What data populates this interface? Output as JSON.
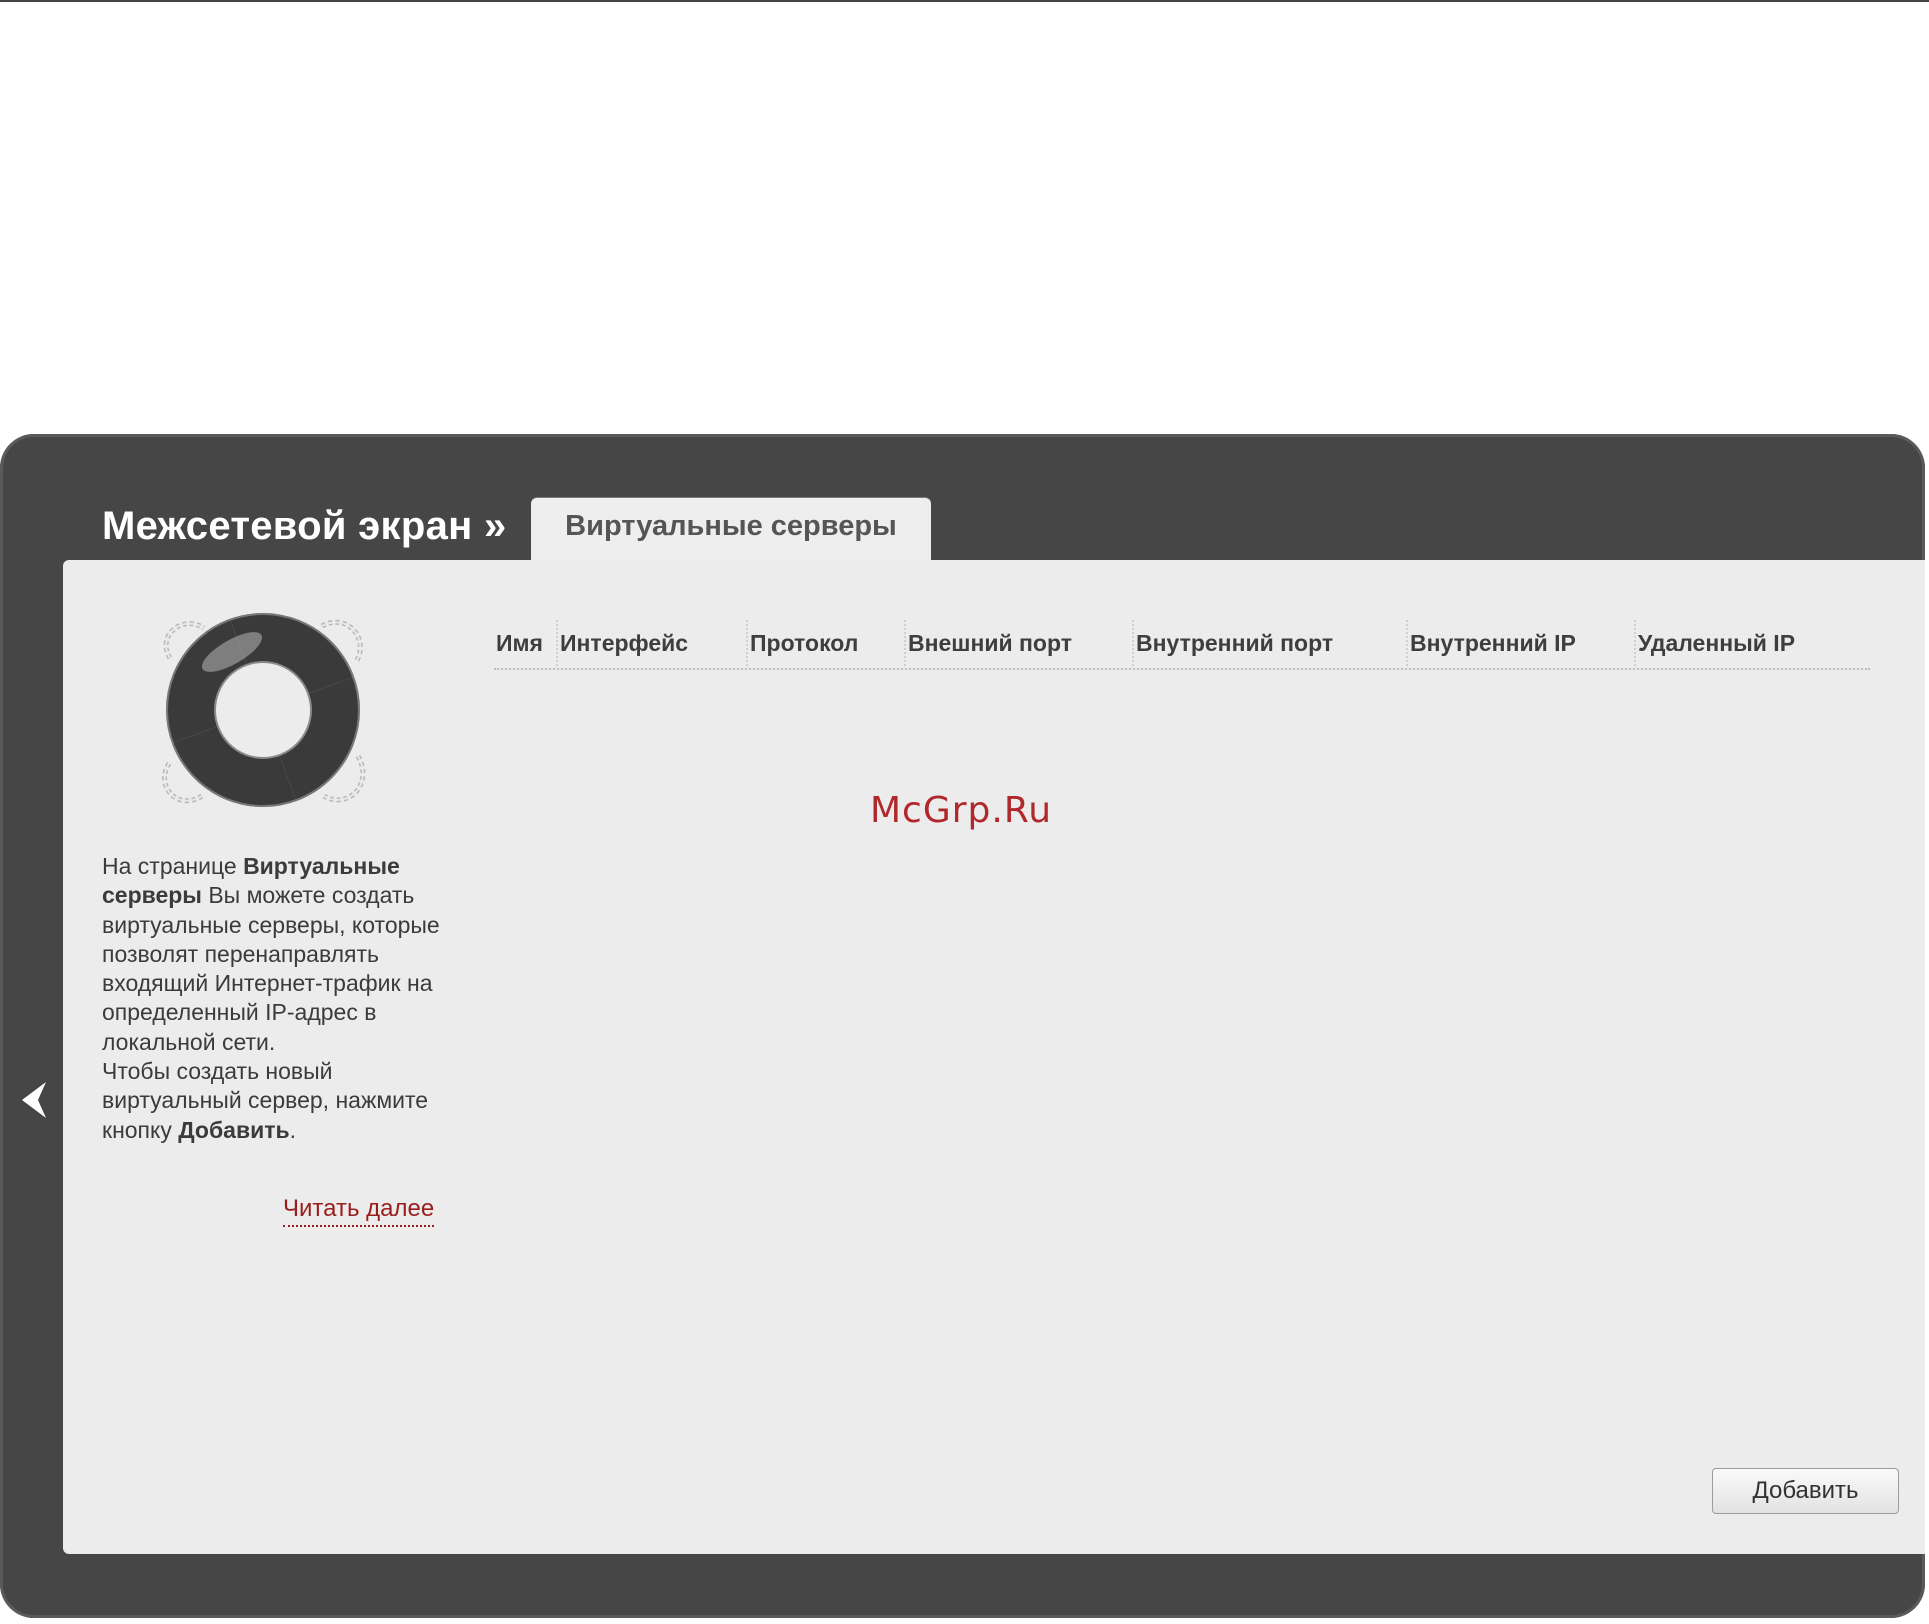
{
  "page": {
    "section_title": "Межсетевой экран »",
    "active_tab": "Виртуальные серверы"
  },
  "sidebar": {
    "help_text": {
      "prefix": "На странице ",
      "page_name": "Виртуальные серверы",
      "body": " Вы можете создать виртуальные серверы, которые позволят перенаправлять входящий Интернет-трафик на определенный IP-адрес в локальной сети.",
      "line2": "Чтобы создать новый виртуальный сервер, нажмите кнопку ",
      "button_name": "Добавить",
      "suffix": "."
    },
    "read_more_label": "Читать далее",
    "back_icon": "chevron-left-icon",
    "illustration_icon": "lifebuoy-icon"
  },
  "table": {
    "columns": [
      "Имя",
      "Интерфейс",
      "Протокол",
      "Внешний порт",
      "Внутренний порт",
      "Внутренний IP",
      "Удаленный IP"
    ],
    "rows": []
  },
  "actions": {
    "add_label": "Добавить"
  },
  "watermark": "McGrp.Ru",
  "colors": {
    "frame": "#464646",
    "panel": "#ececec",
    "link": "#9a1c1c",
    "watermark": "#b0282b"
  }
}
